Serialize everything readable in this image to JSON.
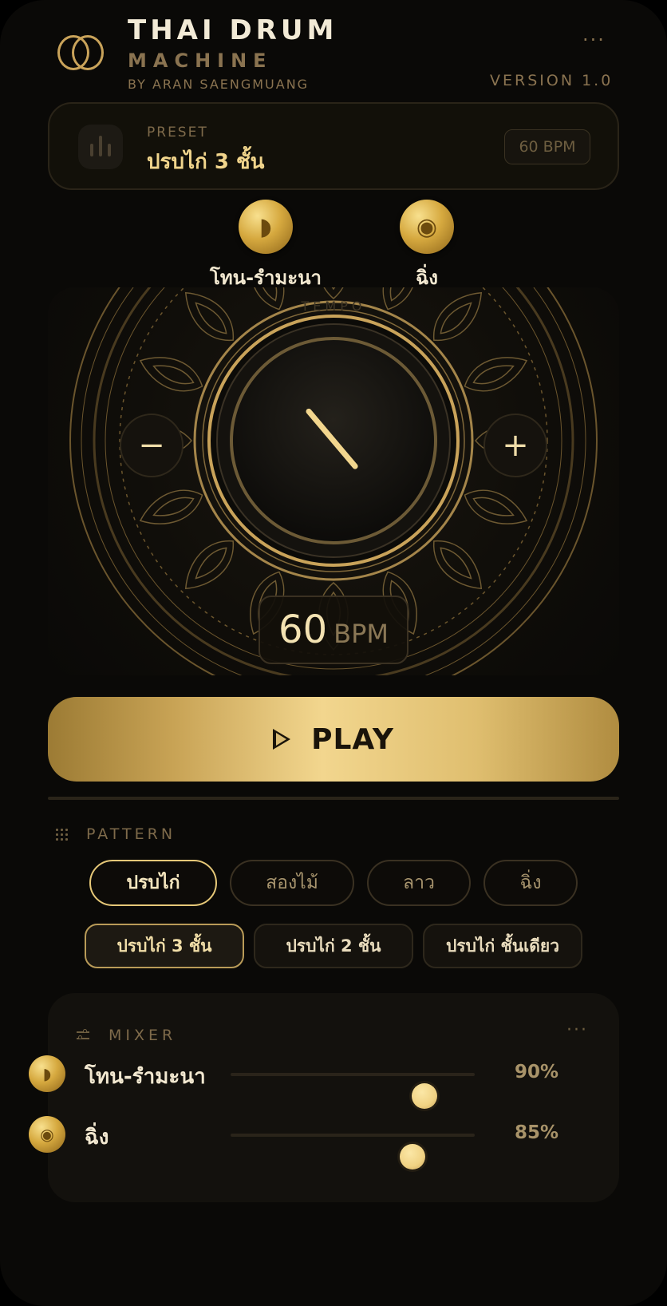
{
  "header": {
    "title_line1": "THAI DRUM",
    "title_line2": "MACHINE",
    "byline": "BY ARAN SAENGMUANG",
    "version": "VERSION 1.0",
    "menu_dots": "···"
  },
  "preset": {
    "label": "PRESET",
    "name": "ปรบไก่ 3 ชั้น",
    "bpm_badge": "60 BPM"
  },
  "instruments": [
    {
      "name": "โทน-รำมะนา",
      "icon": "drum-icon",
      "glyph": "◗"
    },
    {
      "name": "ฉิ่ง",
      "icon": "cymbal-icon",
      "glyph": "◉"
    }
  ],
  "tempo": {
    "ghost_label": "TEMPO",
    "minus": "−",
    "plus": "+",
    "bpm_value": "60",
    "bpm_unit": "BPM",
    "dial_fraction": 0.27
  },
  "play": {
    "label": "PLAY"
  },
  "pattern": {
    "title": "PATTERN",
    "rhythms": [
      "ปรบไก่",
      "สองไม้",
      "ลาว",
      "ฉิ่ง"
    ],
    "active_rhythm": 0,
    "variants": [
      "ปรบไก่ 3 ชั้น",
      "ปรบไก่ 2 ชั้น",
      "ปรบไก่ ชั้นเดียว"
    ],
    "active_variant": 0
  },
  "mixer": {
    "title": "MIXER",
    "menu_dots": "···",
    "tracks": [
      {
        "name": "โทน-รำมะนา",
        "volume": 0.9,
        "percent": "90%",
        "icon": "drum-icon"
      },
      {
        "name": "ฉิ่ง",
        "volume": 0.85,
        "percent": "85%",
        "icon": "cymbal-icon"
      }
    ]
  },
  "colors": {
    "accent_gold": "#f2d68e",
    "background": "#0a0907",
    "muted_text": "#8a7350"
  }
}
